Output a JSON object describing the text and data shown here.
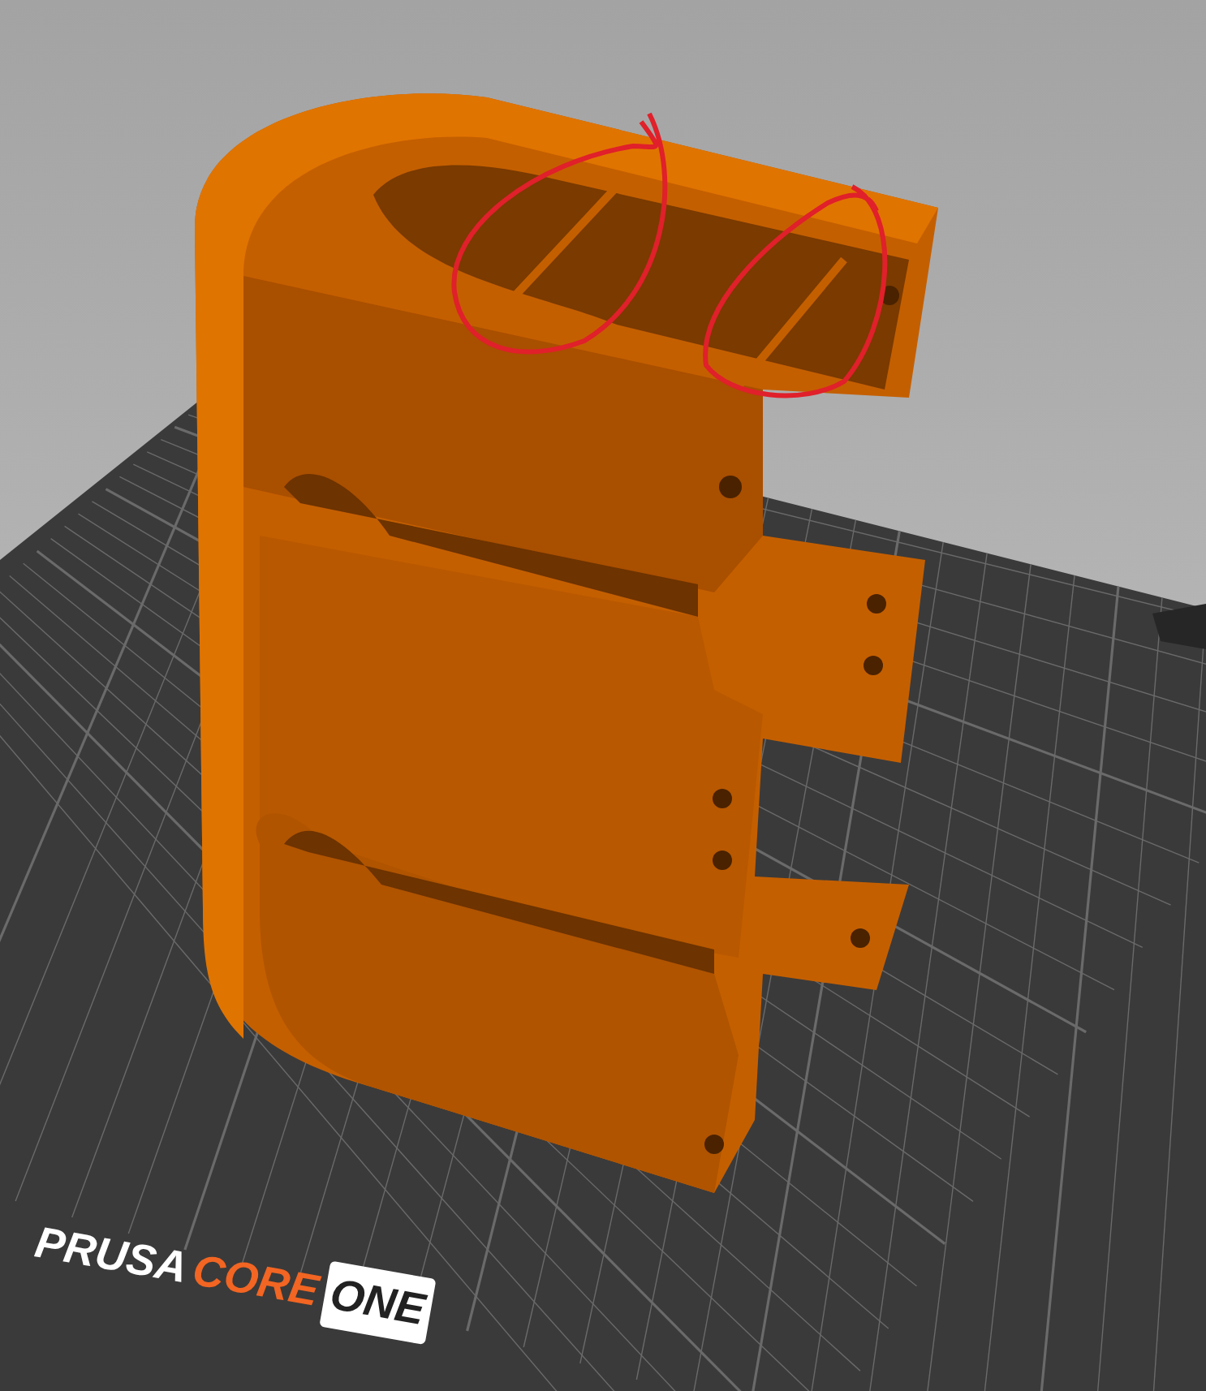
{
  "viewport": {
    "bed_logo": [
      {
        "text": "PRUSA",
        "kind": "plain"
      },
      {
        "text": "CORE",
        "kind": "accent"
      },
      {
        "text": "ONE",
        "kind": "boxed"
      }
    ]
  }
}
